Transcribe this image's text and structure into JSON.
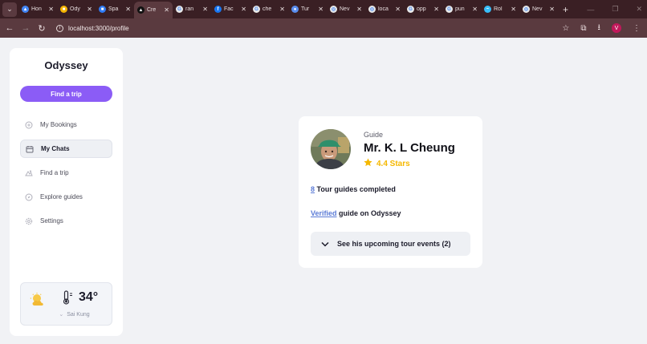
{
  "browser": {
    "tabs": [
      {
        "label": "Hon",
        "color": "#4285f4",
        "glyph": "▲"
      },
      {
        "label": "Ody",
        "color": "#f4b400",
        "glyph": "■"
      },
      {
        "label": "Spa",
        "color": "#2f7bf5",
        "glyph": "■"
      },
      {
        "label": "Cre",
        "color": "#111111",
        "glyph": "▲",
        "active": true
      },
      {
        "label": "ran",
        "color": "#e8e8e8",
        "glyph": "G"
      },
      {
        "label": "Fac",
        "color": "#1877f2",
        "glyph": "f"
      },
      {
        "label": "che",
        "color": "#e8e8e8",
        "glyph": "G"
      },
      {
        "label": "Tur",
        "color": "#5a8dee",
        "glyph": "●"
      },
      {
        "label": "Nev",
        "color": "#e8e8e8",
        "glyph": "◎"
      },
      {
        "label": "loca",
        "color": "#e8e8e8",
        "glyph": "◎"
      },
      {
        "label": "opp",
        "color": "#e8e8e8",
        "glyph": "G"
      },
      {
        "label": "pun",
        "color": "#e8e8e8",
        "glyph": "G"
      },
      {
        "label": "Rol",
        "color": "#38bdf8",
        "glyph": "~"
      },
      {
        "label": "Nev",
        "color": "#e8e8e8",
        "glyph": "◎"
      }
    ],
    "url": "localhost:3000/profile",
    "profile_initial": "V"
  },
  "sidebar": {
    "brand": "Odyssey",
    "find_trip_button": "Find a trip",
    "items": [
      {
        "label": "My Bookings",
        "icon": "bookings-icon",
        "active": false
      },
      {
        "label": "My Chats",
        "icon": "calendar-icon",
        "active": true
      },
      {
        "label": "Find a trip",
        "icon": "map-icon",
        "active": false
      },
      {
        "label": "Explore guides",
        "icon": "compass-icon",
        "active": false
      },
      {
        "label": "Settings",
        "icon": "gear-icon",
        "active": false
      }
    ],
    "weather": {
      "temperature": "34°",
      "location": "Sai Kung",
      "icon": "partly-sunny-icon"
    }
  },
  "profile": {
    "role": "Guide",
    "name": "Mr. K. L Cheung",
    "rating": "4.4 Stars",
    "tours_count": "8",
    "tours_text": " Tour guides completed",
    "verified_link": "Verified",
    "verified_text": " guide on Odyssey",
    "events_button": "See his upcoming tour events (2)"
  },
  "colors": {
    "accent": "#8b5cf6",
    "star": "#f5b800",
    "link": "#5b7bd6",
    "chrome": "#3a1f24"
  }
}
